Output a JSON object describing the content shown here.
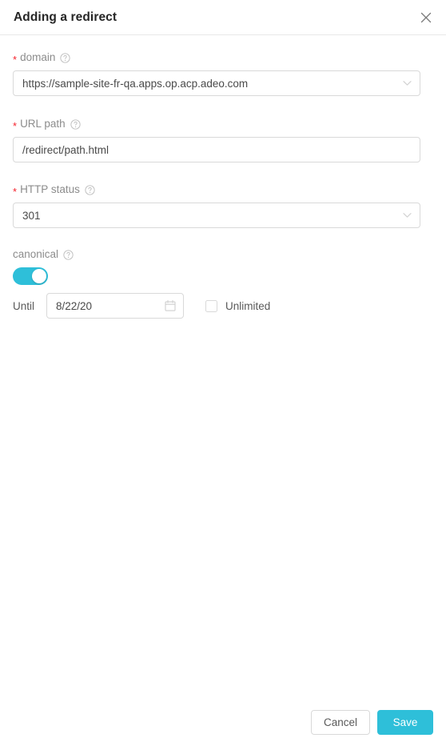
{
  "dialog": {
    "title": "Adding a redirect",
    "close_icon": "close-icon"
  },
  "form": {
    "domain": {
      "label": "domain",
      "required_marker": "*",
      "help_icon": "question-circle-icon",
      "value": "https://sample-site-fr-qa.apps.op.acp.adeo.com",
      "chevron_icon": "chevron-down-icon"
    },
    "url_path": {
      "label": "URL path",
      "required_marker": "*",
      "help_icon": "question-circle-icon",
      "value": "/redirect/path.html"
    },
    "http_status": {
      "label": "HTTP status",
      "required_marker": "*",
      "help_icon": "question-circle-icon",
      "value": "301",
      "chevron_icon": "chevron-down-icon"
    },
    "canonical": {
      "label": "canonical",
      "help_icon": "question-circle-icon",
      "toggle_state": "on"
    },
    "until": {
      "label": "Until",
      "value": "8/22/20",
      "calendar_icon": "calendar-icon"
    },
    "unlimited": {
      "label": "Unlimited",
      "checked": false
    }
  },
  "footer": {
    "cancel_label": "Cancel",
    "save_label": "Save"
  },
  "colors": {
    "accent": "#2ebfd9",
    "required": "#f5222d",
    "border": "#d9d9d9",
    "label": "#8c8c8c"
  }
}
